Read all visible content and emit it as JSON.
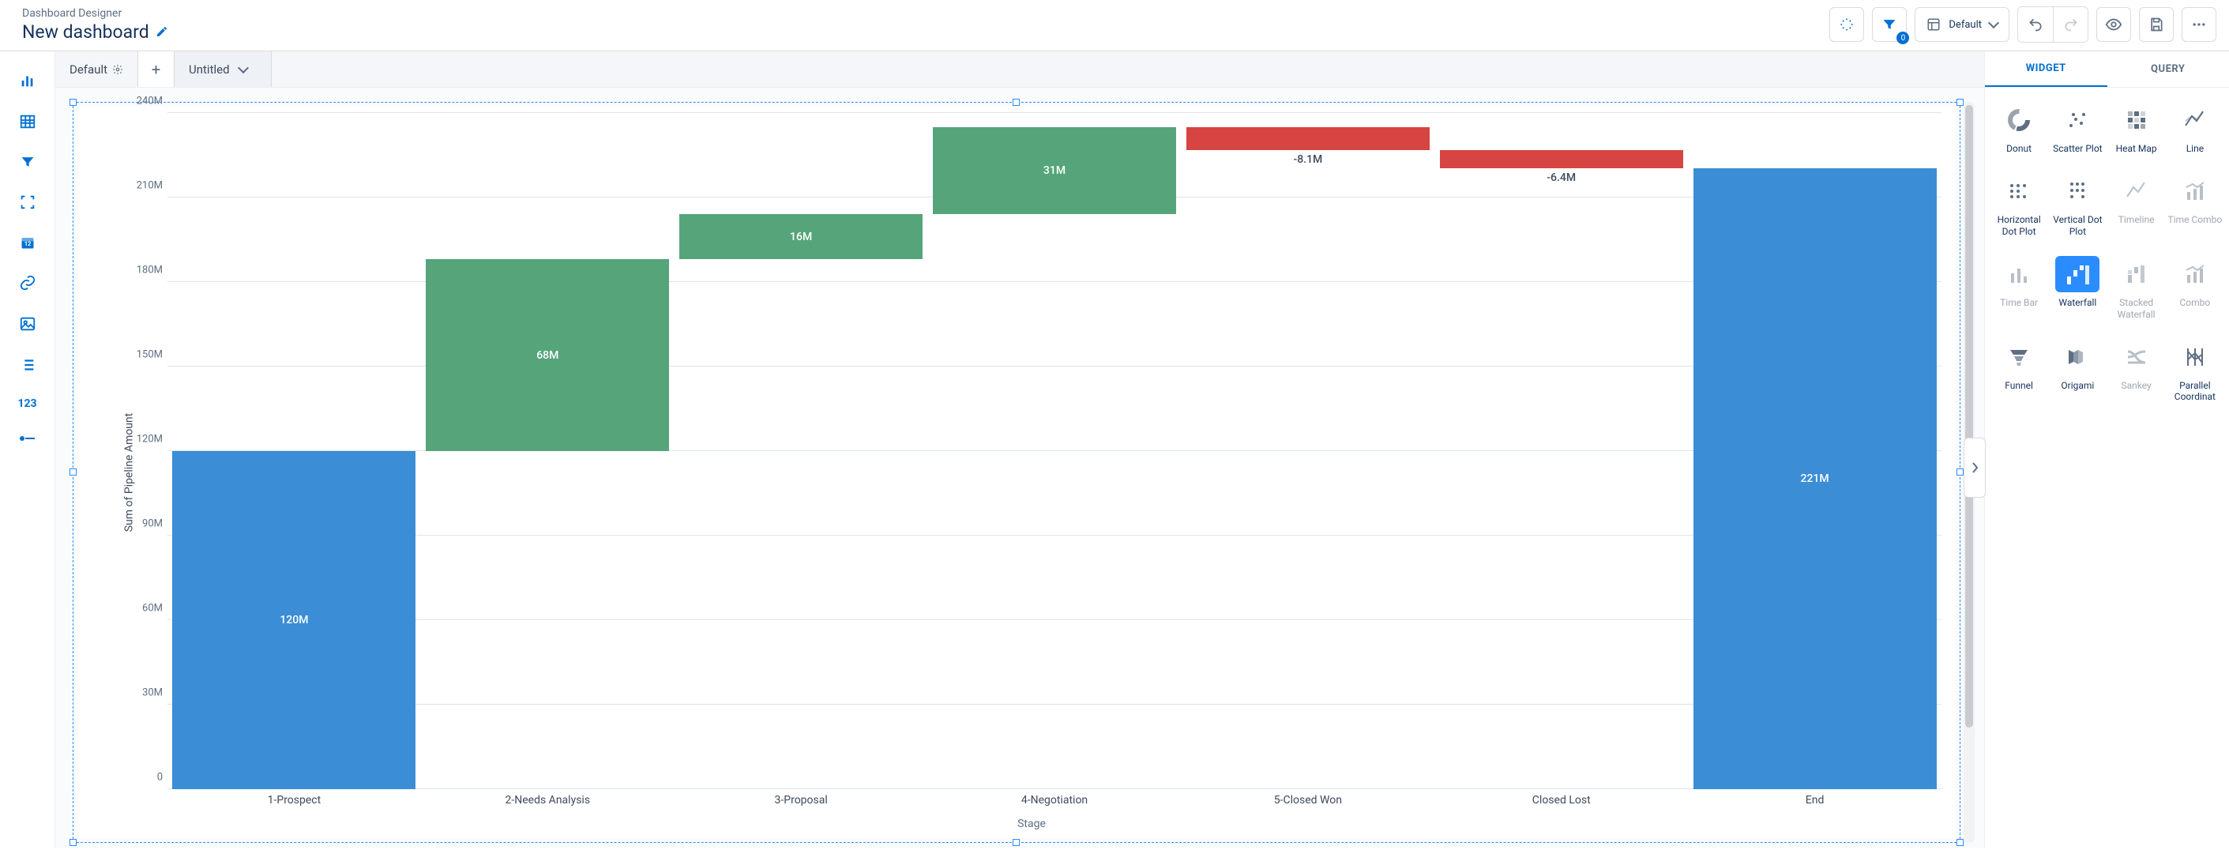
{
  "header": {
    "breadcrumb": "Dashboard Designer",
    "title": "New dashboard",
    "layout_selector": "Default",
    "filter_count": "0"
  },
  "tabs": {
    "default_tab": "Default",
    "main_tab": "Untitled"
  },
  "right_panel": {
    "tab_widget": "WIDGET",
    "tab_query": "QUERY",
    "items": {
      "donut": "Donut",
      "scatter": "Scatter Plot",
      "heatmap": "Heat Map",
      "line": "Line",
      "hdot": "Horizontal Dot Plot",
      "vdot": "Vertical Dot Plot",
      "timeline": "Timeline",
      "timecombo": "Time Combo",
      "timebar": "Time Bar",
      "waterfall": "Waterfall",
      "stackedwf": "Stacked Waterfall",
      "combo": "Combo",
      "funnel": "Funnel",
      "origami": "Origami",
      "sankey": "Sankey",
      "parallel": "Parallel Coordinat"
    }
  },
  "left_rail_number": "123",
  "chart_data": {
    "type": "bar",
    "subtype": "waterfall",
    "xlabel": "Stage",
    "ylabel": "Sum of Pipeline Amount",
    "ylim": [
      0,
      240
    ],
    "yticks": [
      "0",
      "30M",
      "60M",
      "90M",
      "120M",
      "150M",
      "180M",
      "210M",
      "240M"
    ],
    "categories": [
      "1-Prospect",
      "2-Needs Analysis",
      "3-Proposal",
      "4-Negotiation",
      "5-Closed Won",
      "Closed Lost",
      "End"
    ],
    "bars": [
      {
        "label": "120M",
        "start": 0,
        "end": 120,
        "kind": "start"
      },
      {
        "label": "68M",
        "start": 120,
        "end": 188,
        "kind": "inc"
      },
      {
        "label": "16M",
        "start": 188,
        "end": 204,
        "kind": "inc"
      },
      {
        "label": "31M",
        "start": 204,
        "end": 235,
        "kind": "inc"
      },
      {
        "label": "-8.1M",
        "start": 235,
        "end": 226.9,
        "kind": "dec"
      },
      {
        "label": "-6.4M",
        "start": 226.9,
        "end": 220.5,
        "kind": "dec"
      },
      {
        "label": "221M",
        "start": 0,
        "end": 220.5,
        "kind": "end"
      }
    ]
  }
}
